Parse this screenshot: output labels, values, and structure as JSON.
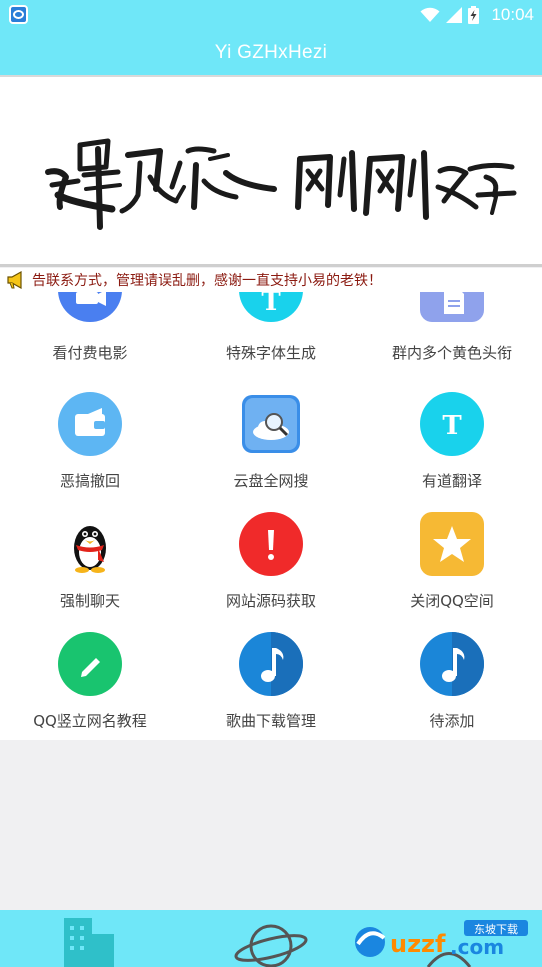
{
  "status_bar": {
    "time": "10:04",
    "icons": [
      "app-notification-icon",
      "wifi-icon",
      "signal-icon",
      "battery-charging-icon"
    ]
  },
  "app_title": "Yi GZHxHezi",
  "notice": {
    "icon": "megaphone-icon",
    "text": "告联系方式，管理请误乱删，感谢一直支持小易的老铁！"
  },
  "grid": [
    [
      {
        "label": "看付费电影",
        "icon": "movie-camera-icon",
        "color": "#4a7ff0"
      },
      {
        "label": "特殊字体生成",
        "icon": "font-t-icon",
        "color": "#19d2ec"
      },
      {
        "label": "群内多个黄色头衔",
        "icon": "document-icon",
        "color": "#8fa2ec"
      }
    ],
    [
      {
        "label": "恶搞撤回",
        "icon": "wallet-icon",
        "color": "#5db6f3"
      },
      {
        "label": "云盘全网搜",
        "icon": "cloud-search-icon",
        "color": "#3a8ee8"
      },
      {
        "label": "有道翻译",
        "icon": "font-t-icon",
        "color": "#19d2ec"
      }
    ],
    [
      {
        "label": "强制聊天",
        "icon": "qq-penguin-icon",
        "color": "#000000"
      },
      {
        "label": "网站源码获取",
        "icon": "exclamation-icon",
        "color": "#f02a2a"
      },
      {
        "label": "关闭QQ空间",
        "icon": "star-icon",
        "color": "#f6b934"
      }
    ],
    [
      {
        "label": "QQ竖立网名教程",
        "icon": "pencil-icon",
        "color": "#19c46f"
      },
      {
        "label": "歌曲下载管理",
        "icon": "music-note-icon",
        "color": "#1b86d8"
      },
      {
        "label": "待添加",
        "icon": "music-note-icon",
        "color": "#1b86d8"
      }
    ]
  ],
  "tabs": [
    {
      "icon": "buildings-icon"
    },
    {
      "icon": "planet-icon"
    },
    {
      "icon": "profile-icon"
    }
  ],
  "watermark": {
    "text": "uzzf.com",
    "badge": "东坡下载"
  },
  "colors": {
    "accent": "#6fe7f8",
    "notice_text": "#8b1a10"
  }
}
